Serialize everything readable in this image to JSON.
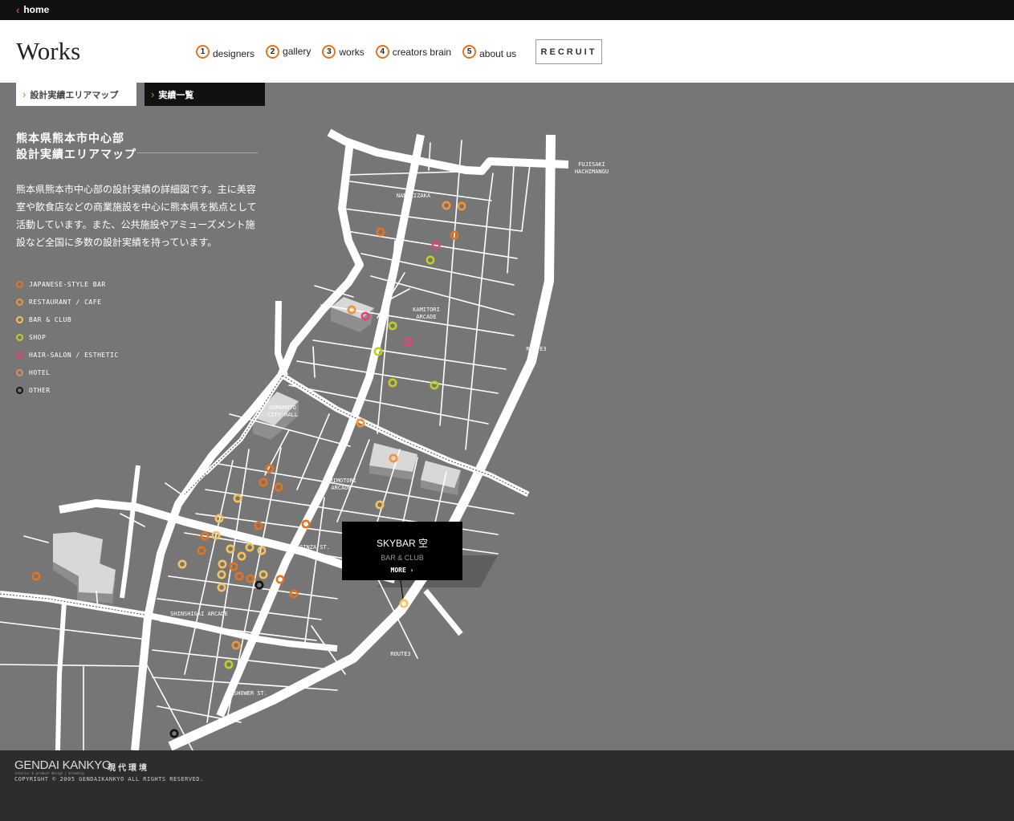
{
  "topbar": {
    "home_label": "home"
  },
  "header": {
    "title": "Works",
    "nav": [
      {
        "num": "1",
        "label": "designers"
      },
      {
        "num": "2",
        "label": "gallery"
      },
      {
        "num": "3",
        "label": "works"
      },
      {
        "num": "4",
        "label": "creators brain"
      },
      {
        "num": "5",
        "label": "about us"
      }
    ],
    "recruit_label": "RECRUIT"
  },
  "subtabs": {
    "area_map": "設計実績エリアマップ",
    "works_list": "実績一覧"
  },
  "sidebar": {
    "title_line1": "熊本県熊本市中心部",
    "title_line2": "設計実績エリアマップ",
    "description": "熊本県熊本市中心部の設計実績の詳細図です。主に美容室や飲食店などの商業施設を中心に熊本県を拠点として活動しています。また、公共施設やアミューズメント施設など全国に多数の設計実績を持っています。"
  },
  "legend": [
    {
      "label": "JAPANESE-STYLE BAR",
      "color": "#e8731e"
    },
    {
      "label": "RESTAURANT / CAFE",
      "color": "#f0953a"
    },
    {
      "label": "BAR & CLUB",
      "color": "#f6c35a"
    },
    {
      "label": "SHOP",
      "color": "#c4cc24"
    },
    {
      "label": "HAIR-SALON / ESTHETIC",
      "color": "#e8417a"
    },
    {
      "label": "HOTEL",
      "color": "#d89060"
    },
    {
      "label": "OTHER",
      "color": "#111111"
    }
  ],
  "map_labels": {
    "fujisaki_1": "FUJISAKI",
    "fujisaki_2": "HACHIMANGU",
    "namikizaka": "NAMIKIZAKA",
    "kamitori_1": "KAMITORI",
    "kamitori_2": "ARCADE",
    "route3_east": "ROUTE3",
    "city_hall_1": "KUMAMOTO",
    "city_hall_2": "CITY HALL",
    "shimotori_1": "SHIMOTORI",
    "shimotori_2": "ARCADE",
    "ginza": "GINZA ST.",
    "shinshigai": "SHINSHIGAI ARCADE",
    "route3_south": "ROUTE3",
    "shower": "SHOWER ST."
  },
  "popup": {
    "title": "SKYBAR 空",
    "category": "BAR & CLUB",
    "more_label": "MORE ›"
  },
  "footer": {
    "logo": "GENDAI KANKYO",
    "logo_sub": "interior & product design | branding",
    "logo_jp": "現代環境",
    "copyright": "COPYRIGHT © 2005 GENDAIKANKYO ALL RIGHTS RESERVED."
  }
}
